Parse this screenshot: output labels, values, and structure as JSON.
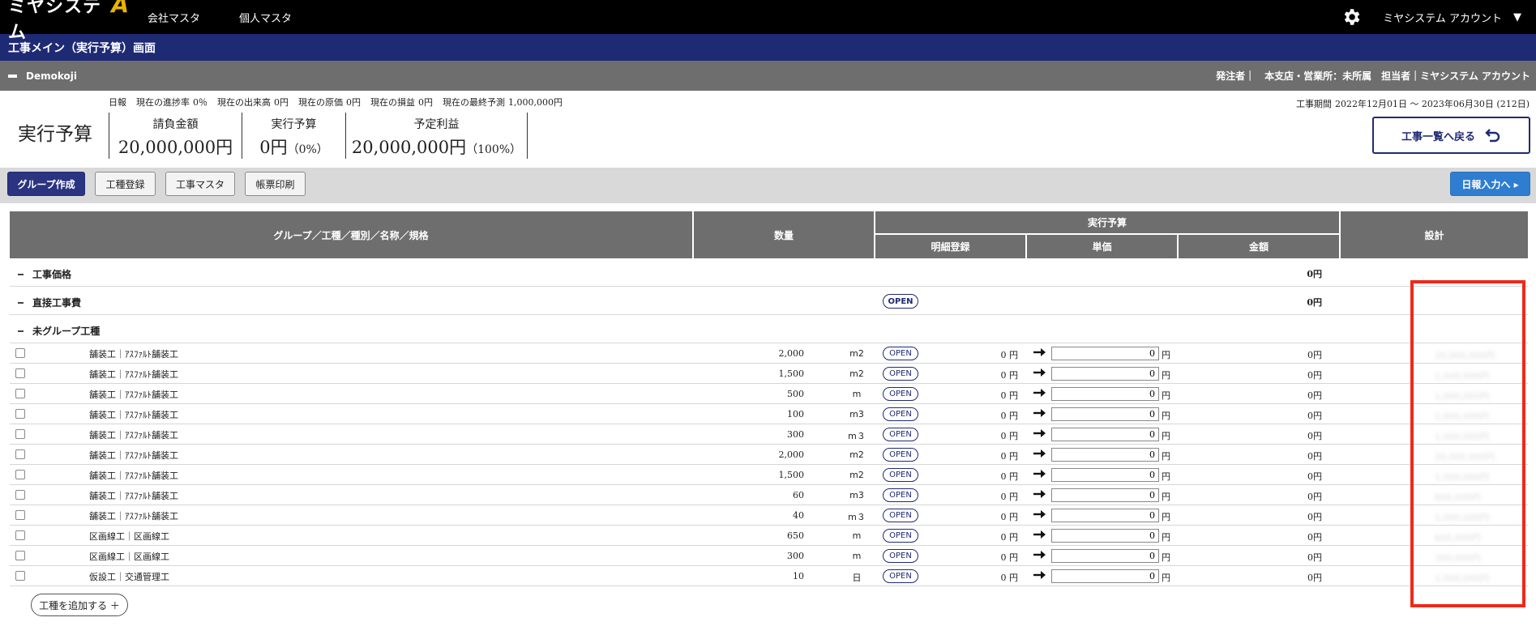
{
  "brand": {
    "name": "ミヤシステム",
    "mark": "A"
  },
  "nav": {
    "items": [
      "会社マスタ",
      "個人マスタ"
    ],
    "account": "ミヤシステム アカウント"
  },
  "page_title": "工事メイン（実行予算）画面",
  "project": {
    "name": "Demokoji",
    "orderer": "発注者｜",
    "branch": "本支店・営業所：未所属",
    "manager": "担当者｜ミヤシステム アカウント"
  },
  "stats": [
    {
      "label": "日報",
      "value": ""
    },
    {
      "label": "現在の進捗率",
      "value": "0％"
    },
    {
      "label": "現在の出来高",
      "value": "0円"
    },
    {
      "label": "現在の原価",
      "value": "0円"
    },
    {
      "label": "現在の損益",
      "value": "0円"
    },
    {
      "label": "現在の最終予測",
      "value": "1,000,000円"
    }
  ],
  "period": {
    "label": "工事期間",
    "value": "2022年12月01日 〜 2023年06月30日 (212日)"
  },
  "summary": {
    "title": "実行予算",
    "contract": {
      "label": "請負金額",
      "amount": "20,000,000円",
      "pct": ""
    },
    "budget": {
      "label": "実行予算",
      "amount": "0円",
      "pct": "（0%）"
    },
    "profit": {
      "label": "予定利益",
      "amount": "20,000,000円",
      "pct": "（100%）"
    },
    "back_label": "工事一覧へ戻る"
  },
  "toolbar": {
    "group_create": "グループ作成",
    "type_register": "工種登録",
    "type_master": "工事マスタ",
    "print": "帳票印刷",
    "daily": "日報入力へ ▸"
  },
  "table": {
    "headers": {
      "name": "グループ／工種／種別／名称／規格",
      "qty": "数量",
      "budget": "実行予算",
      "detail": "明細登録",
      "unit_price": "単価",
      "amount": "金額",
      "design": "設計"
    },
    "groups": [
      {
        "name": "工事価格",
        "amount": "0円",
        "open": ""
      },
      {
        "name": "直接工事費",
        "amount": "0円",
        "open": "OPEN"
      },
      {
        "name": "未グループ工種",
        "amount": "",
        "open": ""
      }
    ],
    "rows": [
      {
        "name": "舗装工｜ｱｽﾌｧﾙﾄ舗装工",
        "qty": "2,000",
        "unit": "m2",
        "open": "OPEN",
        "price0": "0 円",
        "input": "0",
        "yen": "円",
        "amount": "0円",
        "design": "20,000,000円"
      },
      {
        "name": "舗装工｜ｱｽﾌｧﾙﾄ舗装工",
        "qty": "1,500",
        "unit": "m2",
        "open": "OPEN",
        "price0": "0 円",
        "input": "0",
        "yen": "円",
        "amount": "0円",
        "design": "1,500,000円"
      },
      {
        "name": "舗装工｜ｱｽﾌｧﾙﾄ舗装工",
        "qty": "500",
        "unit": "m",
        "open": "OPEN",
        "price0": "0 円",
        "input": "0",
        "yen": "円",
        "amount": "0円",
        "design": "1,000,000円"
      },
      {
        "name": "舗装工｜ｱｽﾌｧﾙﾄ舗装工",
        "qty": "100",
        "unit": "m3",
        "open": "OPEN",
        "price0": "0 円",
        "input": "0",
        "yen": "円",
        "amount": "0円",
        "design": "1,000,000円"
      },
      {
        "name": "舗装工｜ｱｽﾌｧﾙﾄ舗装工",
        "qty": "300",
        "unit": "m３",
        "open": "OPEN",
        "price0": "0 円",
        "input": "0",
        "yen": "円",
        "amount": "0円",
        "design": "1,000,000円"
      },
      {
        "name": "舗装工｜ｱｽﾌｧﾙﾄ舗装工",
        "qty": "2,000",
        "unit": "m2",
        "open": "OPEN",
        "price0": "0 円",
        "input": "0",
        "yen": "円",
        "amount": "0円",
        "design": "20,000,000円"
      },
      {
        "name": "舗装工｜ｱｽﾌｧﾙﾄ舗装工",
        "qty": "1,500",
        "unit": "m2",
        "open": "OPEN",
        "price0": "0 円",
        "input": "0",
        "yen": "円",
        "amount": "0円",
        "design": "1,500,000円"
      },
      {
        "name": "舗装工｜ｱｽﾌｧﾙﾄ舗装工",
        "qty": "60",
        "unit": "m3",
        "open": "OPEN",
        "price0": "0 円",
        "input": "0",
        "yen": "円",
        "amount": "0円",
        "design": "600,000円"
      },
      {
        "name": "舗装工｜ｱｽﾌｧﾙﾄ舗装工",
        "qty": "40",
        "unit": "m３",
        "open": "OPEN",
        "price0": "0 円",
        "input": "0",
        "yen": "円",
        "amount": "0円",
        "design": "1,000,000円"
      },
      {
        "name": "区画線工｜区画線工",
        "qty": "650",
        "unit": "m",
        "open": "OPEN",
        "price0": "0 円",
        "input": "0",
        "yen": "円",
        "amount": "0円",
        "design": "650,000円"
      },
      {
        "name": "区画線工｜区画線工",
        "qty": "300",
        "unit": "m",
        "open": "OPEN",
        "price0": "0 円",
        "input": "0",
        "yen": "円",
        "amount": "0円",
        "design": "300,000円"
      },
      {
        "name": "仮設工｜交通管理工",
        "qty": "10",
        "unit": "日",
        "open": "OPEN",
        "price0": "0 円",
        "input": "0",
        "yen": "円",
        "amount": "0円",
        "design": "1,000,000円"
      }
    ],
    "add_label": "工種を追加する ＋"
  },
  "colors": {
    "nav_bg": "#000000",
    "title_bg": "#1f2a74",
    "project_bg": "#6e6e6e",
    "highlight": "#ee2a1a",
    "primary": "#2b3480",
    "blue": "#2e7dd0"
  }
}
